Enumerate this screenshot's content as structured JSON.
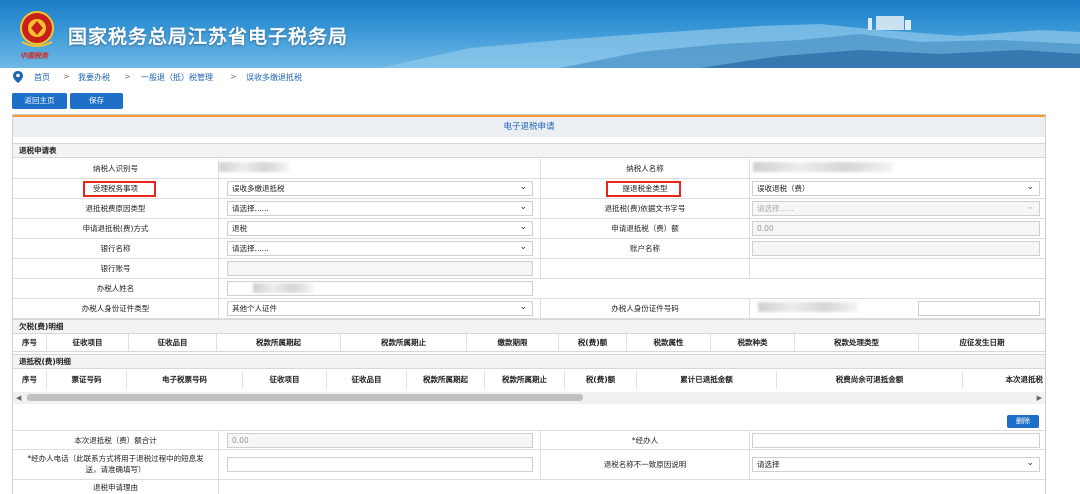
{
  "header": {
    "site_title": "国家税务总局江苏省电子税务局",
    "emblem_text": "中国税务"
  },
  "breadcrumb": [
    "首页",
    "我要办税",
    "一般退（抵）税管理",
    "误收多缴退抵税"
  ],
  "toolbar": {
    "back_label": "返回主页",
    "save_label": "保存"
  },
  "panel": {
    "title": "电子退税申请",
    "section_apply": "退税申请表",
    "section_owed": "欠税(费)明细",
    "section_offset": "退抵税(费)明细"
  },
  "form": {
    "taxpayer_id_label": "纳税人识别号",
    "taxpayer_name_label": "纳税人名称",
    "matter_label": "受理税务事项",
    "matter_value": "误收多缴退抵税",
    "fund_type_label": "提退税金类型",
    "fund_type_value": "误收退税（费）",
    "reason_type_label": "退抵税费原因类型",
    "reason_type_value": "请选择......",
    "doc_no_label": "退抵税(费)依据文书字号",
    "doc_no_value": "请选择......",
    "method_label": "申请退抵税(费)方式",
    "method_value": "退税",
    "amount_label": "申请退抵税（费）额",
    "amount_value": "0.00",
    "bank_label": "银行名称",
    "bank_value": "请选择......",
    "account_name_label": "账户名称",
    "account_no_label": "银行账号",
    "handler_name_label": "办税人姓名",
    "id_type_label": "办税人身份证件类型",
    "id_type_value": "其他个人证件",
    "id_no_label": "办税人身份证件号码"
  },
  "owed_table": {
    "headers": [
      "序号",
      "征收项目",
      "征收品目",
      "税款所属期起",
      "税款所属期止",
      "缴款期限",
      "税(费)额",
      "税款属性",
      "税款种类",
      "税款处理类型",
      "应征发生日期"
    ]
  },
  "offset_table": {
    "headers": [
      "序号",
      "票证号码",
      "电子税票号码",
      "征收项目",
      "征收品目",
      "税款所属期起",
      "税款所属期止",
      "税(费)额",
      "累计已退抵金额",
      "税费尚余可退抵金额",
      "本次退抵税"
    ]
  },
  "delete_label": "删除",
  "bottom": {
    "total_label": "本次退抵税（费）额合计",
    "total_value": "0.00",
    "agent_label": "*经办人",
    "phone_label": "*经办人电话（此联系方式将用于退税过程中的短息发送，请准确填写）",
    "mismatch_label": "退税名称不一致原因说明",
    "mismatch_value": "请选择",
    "partial_label": "退税申请理由"
  },
  "colors": {
    "brand": "#1e6fc8",
    "accent": "#f39a2e",
    "highlight": "#e8261b"
  }
}
